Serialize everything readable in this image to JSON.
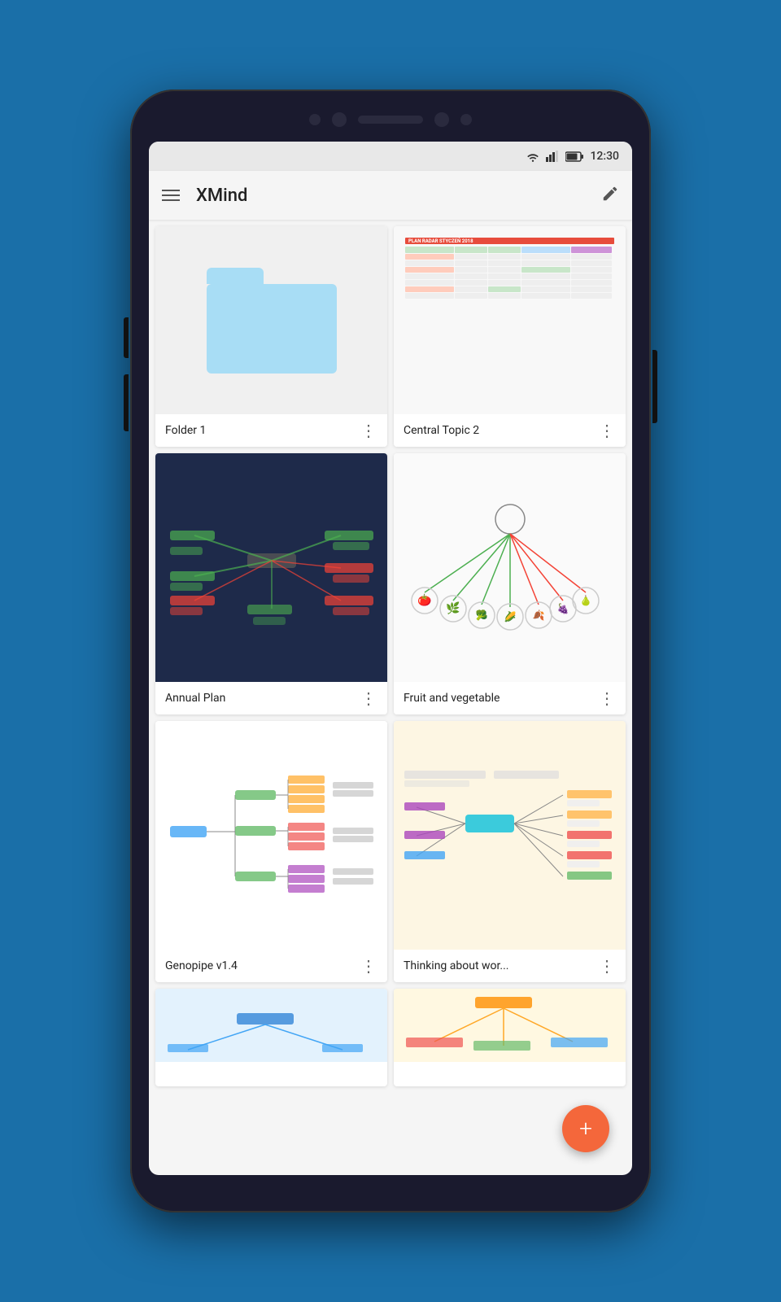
{
  "background_color": "#1a6fa8",
  "status_bar": {
    "time": "12:30",
    "icons": [
      "wifi",
      "signal",
      "battery"
    ]
  },
  "app_bar": {
    "title": "XMind",
    "menu_icon": "hamburger",
    "action_icon": "edit"
  },
  "grid": {
    "items": [
      {
        "id": "folder1",
        "name": "Folder 1",
        "type": "folder",
        "thumb_type": "folder"
      },
      {
        "id": "central-topic-2",
        "name": "Central Topic 2",
        "type": "mindmap",
        "thumb_type": "spreadsheet"
      },
      {
        "id": "annual-plan",
        "name": "Annual Plan",
        "type": "mindmap",
        "thumb_type": "dark-mindmap"
      },
      {
        "id": "fruit-veg",
        "name": "Fruit and vegetable",
        "type": "mindmap",
        "thumb_type": "fruit-mindmap"
      },
      {
        "id": "genopipe",
        "name": "Genopipe v1.4",
        "type": "mindmap",
        "thumb_type": "genopipe-mindmap"
      },
      {
        "id": "thinking",
        "name": "Thinking about wor...",
        "type": "mindmap",
        "thumb_type": "thinking-mindmap"
      },
      {
        "id": "partial1",
        "name": "",
        "type": "mindmap",
        "thumb_type": "partial-blue"
      },
      {
        "id": "partial2",
        "name": "",
        "type": "mindmap",
        "thumb_type": "partial-colorful"
      }
    ],
    "more_label": "⋮"
  },
  "fab": {
    "label": "+"
  }
}
